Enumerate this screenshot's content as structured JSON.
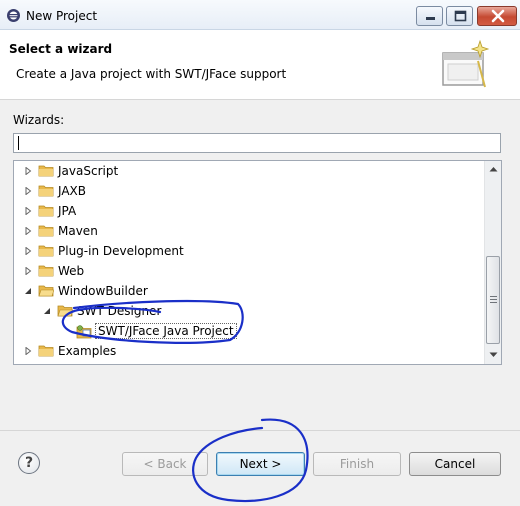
{
  "window": {
    "title": "New Project"
  },
  "header": {
    "title": "Select a wizard",
    "description": "Create a Java project with SWT/JFace support"
  },
  "wizards": {
    "label": "Wizards:",
    "filter_value": "",
    "tree": [
      {
        "label": "JavaScript",
        "level": 0,
        "expanded": false
      },
      {
        "label": "JAXB",
        "level": 0,
        "expanded": false
      },
      {
        "label": "JPA",
        "level": 0,
        "expanded": false
      },
      {
        "label": "Maven",
        "level": 0,
        "expanded": false
      },
      {
        "label": "Plug-in Development",
        "level": 0,
        "expanded": false
      },
      {
        "label": "Web",
        "level": 0,
        "expanded": false
      },
      {
        "label": "WindowBuilder",
        "level": 0,
        "expanded": true
      },
      {
        "label": "SWT Designer",
        "level": 1,
        "expanded": true
      },
      {
        "label": "SWT/JFace Java Project",
        "level": 2,
        "selected": true
      },
      {
        "label": "Examples",
        "level": 0,
        "expanded": false
      }
    ]
  },
  "buttons": {
    "help": "?",
    "back": "< Back",
    "next": "Next >",
    "finish": "Finish",
    "cancel": "Cancel"
  },
  "icons": {
    "app": "eclipse-icon",
    "folder": "folder-icon",
    "project": "swt-project-icon",
    "banner": "wizard-banner-icon"
  },
  "colors": {
    "annotation": "#1a2fc8",
    "folder": "#e8b84a",
    "default_button": "#3c7fb1"
  }
}
